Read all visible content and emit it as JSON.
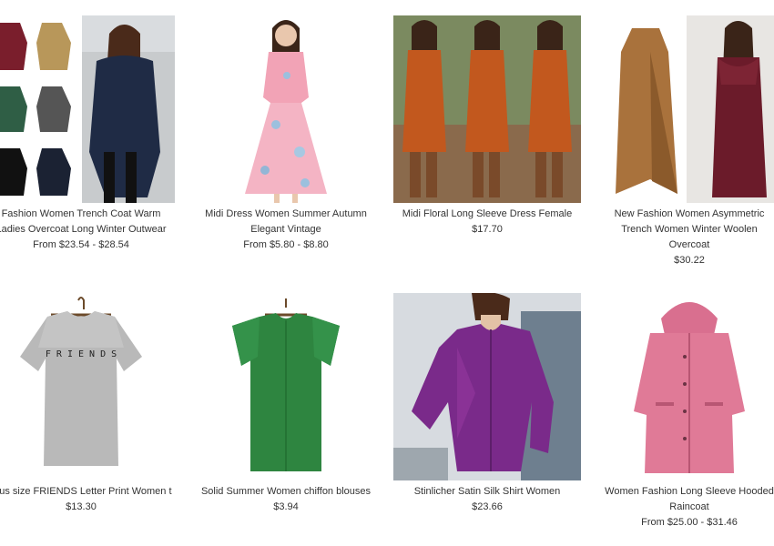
{
  "products": [
    {
      "title_lines": [
        "Fashion Women Trench Coat Warm",
        "Ladies Overcoat Long Winter Outwear"
      ],
      "price": "From $23.54 - $28.54",
      "image": "coat-collage"
    },
    {
      "title_lines": [
        "Midi Dress Women Summer Autumn",
        "Elegant Vintage"
      ],
      "price": "From $5.80 - $8.80",
      "image": "pink-floral-dress"
    },
    {
      "title_lines": [
        "Midi Floral Long Sleeve Dress Female"
      ],
      "price": "$17.70",
      "image": "orange-floral-dress"
    },
    {
      "title_lines": [
        "New Fashion Women Asymmetric",
        "Trench Women Winter Woolen",
        "Overcoat"
      ],
      "price": "$30.22",
      "image": "brown-wrap-coat"
    },
    {
      "title_lines": [
        "Plus size FRIENDS Letter Print Women t"
      ],
      "price": "$13.30",
      "image": "grey-friends-tshirt",
      "shirt_text": "F R I E N D S"
    },
    {
      "title_lines": [
        "Solid Summer Women chiffon blouses"
      ],
      "price": "$3.94",
      "image": "green-chiffon-blouse"
    },
    {
      "title_lines": [
        "Stinlicher Satin Silk Shirt Women"
      ],
      "price": "$23.66",
      "image": "purple-satin-shirt"
    },
    {
      "title_lines": [
        "Women Fashion Long Sleeve Hooded",
        "Raincoat"
      ],
      "price": "From $25.00 - $31.46",
      "image": "pink-raincoat"
    }
  ],
  "colors": {
    "text": "#333333",
    "background": "#ffffff"
  }
}
